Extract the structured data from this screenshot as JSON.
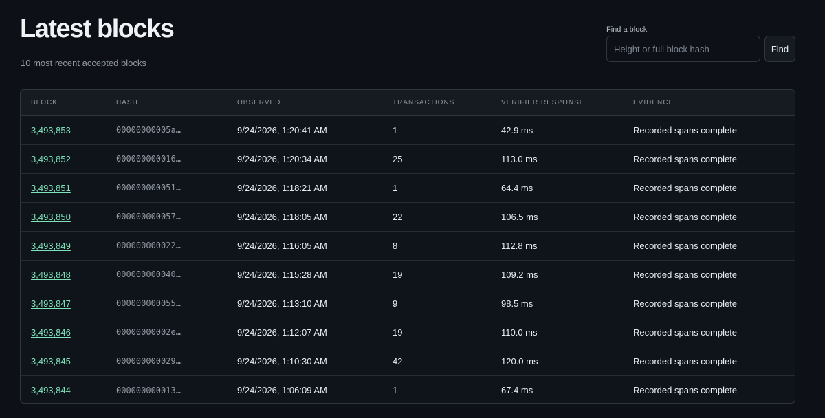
{
  "header": {
    "title": "Latest blocks",
    "subtitle": "10 most recent accepted blocks"
  },
  "search": {
    "label": "Find a block",
    "placeholder": "Height or full block hash",
    "value": "",
    "button_label": "Find"
  },
  "table": {
    "columns": [
      "BLOCK",
      "HASH",
      "OBSERVED",
      "TRANSACTIONS",
      "VERIFIER RESPONSE",
      "EVIDENCE"
    ],
    "rows": [
      {
        "block": "3,493,853",
        "hash": "00000000005a…",
        "observed": "9/24/2026, 1:20:41 AM",
        "transactions": "1",
        "response": "42.9 ms",
        "evidence": "Recorded spans complete"
      },
      {
        "block": "3,493,852",
        "hash": "000000000016…",
        "observed": "9/24/2026, 1:20:34 AM",
        "transactions": "25",
        "response": "113.0 ms",
        "evidence": "Recorded spans complete"
      },
      {
        "block": "3,493,851",
        "hash": "000000000051…",
        "observed": "9/24/2026, 1:18:21 AM",
        "transactions": "1",
        "response": "64.4 ms",
        "evidence": "Recorded spans complete"
      },
      {
        "block": "3,493,850",
        "hash": "000000000057…",
        "observed": "9/24/2026, 1:18:05 AM",
        "transactions": "22",
        "response": "106.5 ms",
        "evidence": "Recorded spans complete"
      },
      {
        "block": "3,493,849",
        "hash": "000000000022…",
        "observed": "9/24/2026, 1:16:05 AM",
        "transactions": "8",
        "response": "112.8 ms",
        "evidence": "Recorded spans complete"
      },
      {
        "block": "3,493,848",
        "hash": "000000000040…",
        "observed": "9/24/2026, 1:15:28 AM",
        "transactions": "19",
        "response": "109.2 ms",
        "evidence": "Recorded spans complete"
      },
      {
        "block": "3,493,847",
        "hash": "000000000055…",
        "observed": "9/24/2026, 1:13:10 AM",
        "transactions": "9",
        "response": "98.5 ms",
        "evidence": "Recorded spans complete"
      },
      {
        "block": "3,493,846",
        "hash": "00000000002e…",
        "observed": "9/24/2026, 1:12:07 AM",
        "transactions": "19",
        "response": "110.0 ms",
        "evidence": "Recorded spans complete"
      },
      {
        "block": "3,493,845",
        "hash": "000000000029…",
        "observed": "9/24/2026, 1:10:30 AM",
        "transactions": "42",
        "response": "120.0 ms",
        "evidence": "Recorded spans complete"
      },
      {
        "block": "3,493,844",
        "hash": "000000000013…",
        "observed": "9/24/2026, 1:06:09 AM",
        "transactions": "1",
        "response": "67.4 ms",
        "evidence": "Recorded spans complete"
      }
    ]
  },
  "colors": {
    "background": "#0d1117",
    "link": "#7ee2b8",
    "border": "#30363d"
  }
}
